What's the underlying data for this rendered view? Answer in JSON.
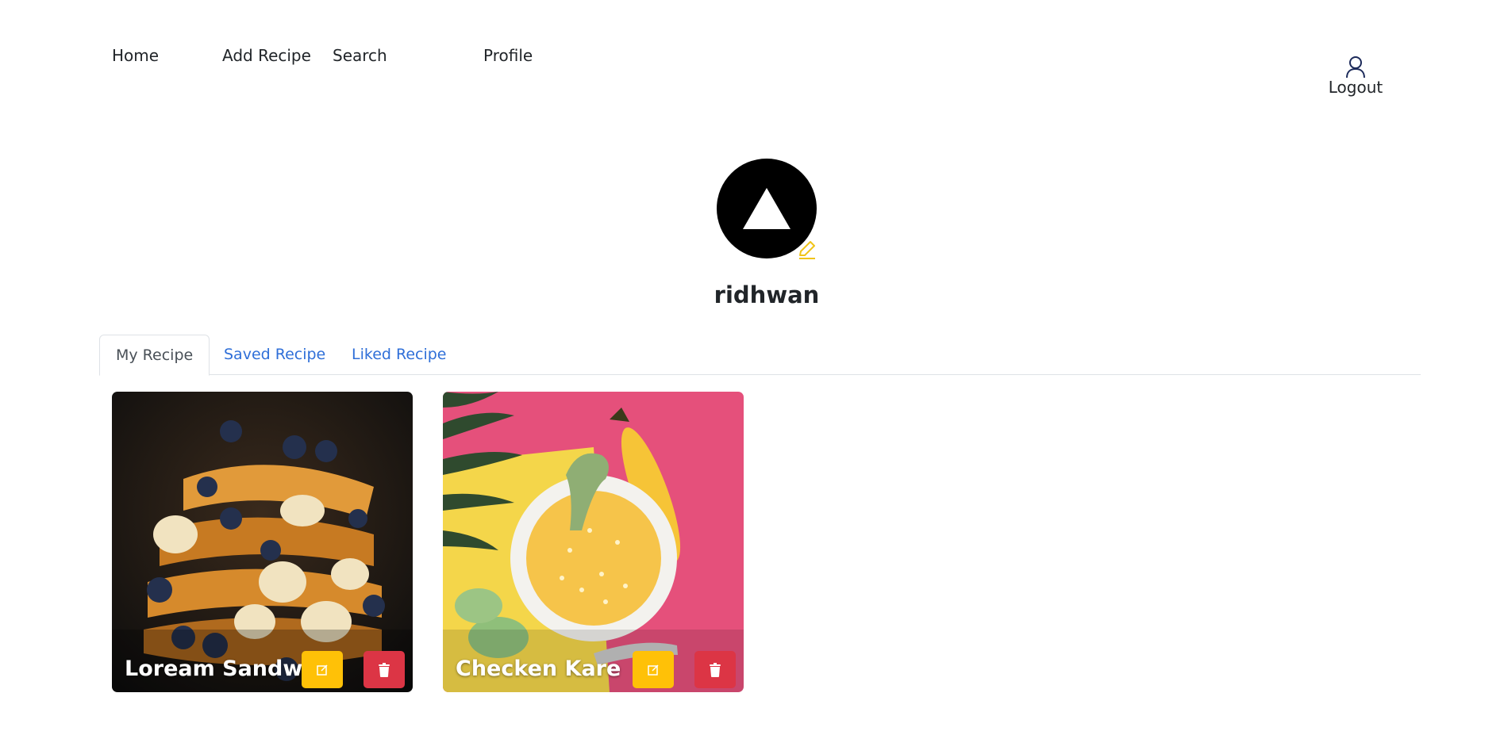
{
  "nav": {
    "home": "Home",
    "add_recipe": "Add Recipe",
    "search": "Search",
    "profile": "Profile",
    "logout": "Logout",
    "logout_icon": "user-icon"
  },
  "profile": {
    "username": "ridhwan",
    "avatar_icon": "triangle-logo",
    "edit_icon": "pencil-icon"
  },
  "tabs": [
    {
      "label": "My Recipe",
      "active": true
    },
    {
      "label": "Saved Recipe",
      "active": false
    },
    {
      "label": "Liked Recipe",
      "active": false
    }
  ],
  "recipes": [
    {
      "title": "Loream Sandwich",
      "edit_icon": "edit-icon",
      "delete_icon": "trash-icon"
    },
    {
      "title": "Checken Kare",
      "edit_icon": "edit-icon",
      "delete_icon": "trash-icon"
    }
  ],
  "colors": {
    "accent_blue": "#2f6fd8",
    "edit_yellow": "#ffc107",
    "delete_red": "#dc3545",
    "pencil_yellow": "#f0c419"
  }
}
